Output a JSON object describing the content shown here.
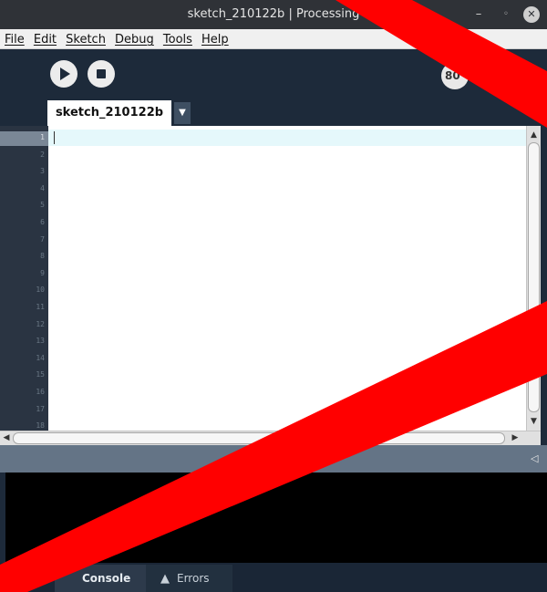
{
  "window": {
    "title": "sketch_210122b | Processing",
    "controls": {
      "minimize": "–",
      "maximize": "◦",
      "close": "✕"
    }
  },
  "menubar": {
    "items": [
      "File",
      "Edit",
      "Sketch",
      "Debug",
      "Tools",
      "Help"
    ]
  },
  "toolbar": {
    "run_icon": "run-play-icon",
    "stop_icon": "stop-square-icon",
    "mode_label": "80"
  },
  "tabs": {
    "active_label": "sketch_210122b",
    "menu_glyph": "▼"
  },
  "editor": {
    "line_numbers": [
      "1",
      "2",
      "3",
      "4",
      "5",
      "6",
      "7",
      "8",
      "9",
      "10",
      "11",
      "12",
      "13",
      "14",
      "15",
      "16",
      "17",
      "18"
    ],
    "active_line": 1,
    "content": ""
  },
  "scrollbars": {
    "up": "▲",
    "down": "▼",
    "left": "◀",
    "right": "▶"
  },
  "message_area": {
    "collapse_glyph": "◁"
  },
  "footer": {
    "console_label": "Console",
    "errors_label": "Errors",
    "errors_icon": "warning-triangle-icon"
  },
  "overlay": {
    "color": "#ff0000"
  }
}
